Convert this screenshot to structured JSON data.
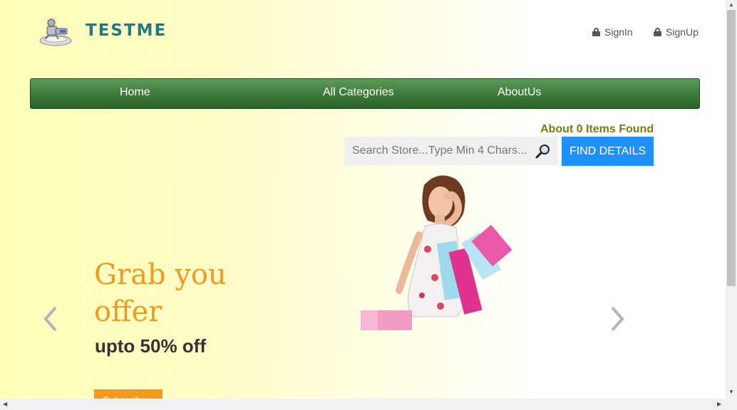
{
  "header": {
    "brand": "TESTME",
    "signin_label": "SignIn",
    "signup_label": "SignUp"
  },
  "nav": {
    "items": [
      {
        "label": "Home"
      },
      {
        "label": "All Categories"
      },
      {
        "label": "AboutUs"
      }
    ]
  },
  "search": {
    "result_text": "About 0 Items Found",
    "placeholder": "Search Store...Type Min 4 Chars...",
    "button_label": "FIND DETAILS"
  },
  "carousel": {
    "title": "Grab you offer",
    "subtitle": "upto 50% off",
    "button_label": "Subscribe"
  },
  "colors": {
    "accent_orange": "#f39a1e",
    "nav_green": "#3f7c3b",
    "button_blue": "#1e90ff",
    "found_text": "#7a7a12",
    "brand_teal": "#1e7a86"
  },
  "icons": [
    "logo-icon",
    "lock-icon",
    "search-icon",
    "chevron-left-icon",
    "chevron-right-icon"
  ]
}
